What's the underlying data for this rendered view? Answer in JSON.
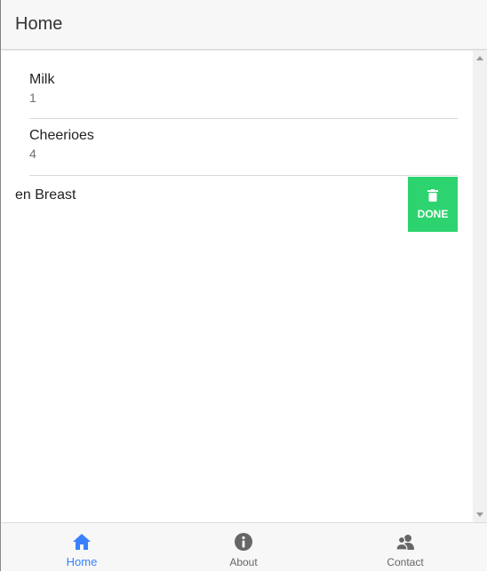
{
  "header": {
    "title": "Home"
  },
  "items": [
    {
      "name": "Milk",
      "quantity": "1"
    },
    {
      "name": "Cheerioes",
      "quantity": "4"
    },
    {
      "name": "en Breast",
      "action_label": "DONE"
    }
  ],
  "tabs": [
    {
      "label": "Home",
      "icon": "home-icon",
      "active": true
    },
    {
      "label": "About",
      "icon": "info-icon",
      "active": false
    },
    {
      "label": "Contact",
      "icon": "contacts-icon",
      "active": false
    }
  ],
  "colors": {
    "accent": "#3880ff",
    "done": "#2dd36f",
    "header_bg": "#f7f7f7",
    "tab_inactive": "#666666"
  }
}
